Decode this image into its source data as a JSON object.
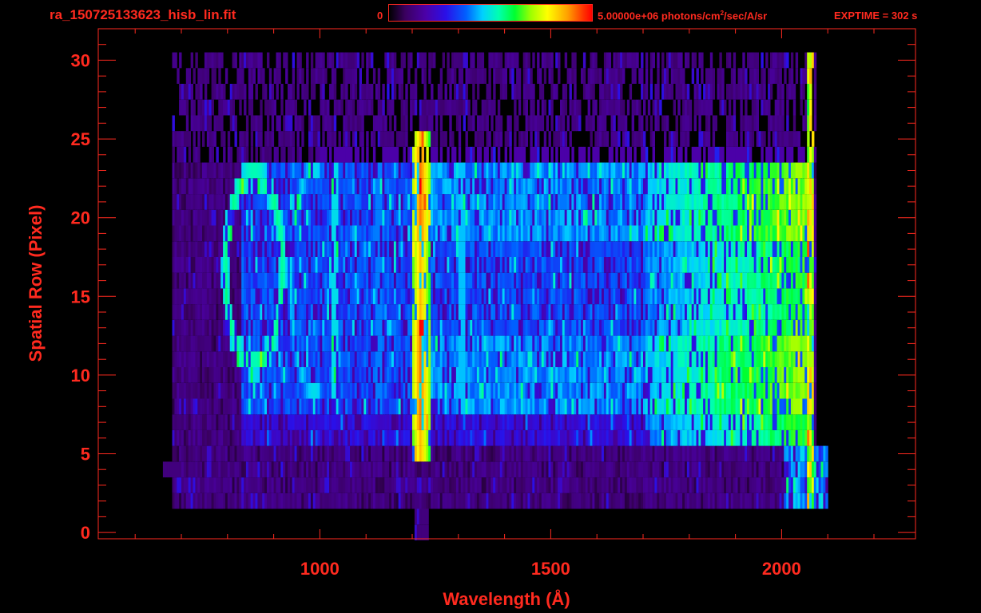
{
  "header": {
    "filename": "ra_150725133623_hisb_lin.fit",
    "colorbar_min": "0",
    "colorbar_max_prefix": "5.00000e+06 photons/cm",
    "colorbar_max_exp": "2",
    "colorbar_max_suffix": "/sec/A/sr",
    "exptime": "EXPTIME = 302 s"
  },
  "colors": {
    "axis": "#ff2a1f",
    "background": "#000000"
  },
  "chart_data": {
    "type": "heatmap",
    "title": "ra_150725133623_hisb_lin.fit",
    "xlabel": "Wavelength (Å)",
    "ylabel": "Spatial Row (Pixel)",
    "xlim": [
      520,
      2290
    ],
    "ylim": [
      -0.4,
      32
    ],
    "x_ticks": [
      1000,
      1500,
      2000
    ],
    "x_tick_labels": [
      "1000",
      "1500",
      "2000"
    ],
    "y_ticks": [
      0,
      5,
      10,
      15,
      20,
      25,
      30
    ],
    "y_tick_labels": [
      "0",
      "5",
      "10",
      "15",
      "20",
      "25",
      "30"
    ],
    "colorbar": {
      "min": 0,
      "max": 5000000,
      "units": "photons/cm^2/sec/A/sr"
    },
    "colormap": "rainbow",
    "features": [
      {
        "description": "emission line",
        "x": 1216,
        "y_range": [
          5,
          25
        ],
        "level": 0.9
      },
      {
        "description": "continuum rising toward red end",
        "x_range": [
          1750,
          2065
        ],
        "y_range": [
          6,
          23
        ],
        "level": 0.55
      },
      {
        "description": "signal band",
        "x_range": [
          830,
          2065
        ],
        "y_range": [
          8,
          23
        ],
        "level": 0.35
      },
      {
        "description": "sparse noise rows",
        "x_range": [
          680,
          2070
        ],
        "y_range": [
          2,
          30
        ],
        "level": 0.15
      },
      {
        "description": "detector edge column",
        "x": 2060,
        "y_range": [
          2,
          30
        ],
        "level": 0.7
      }
    ]
  }
}
